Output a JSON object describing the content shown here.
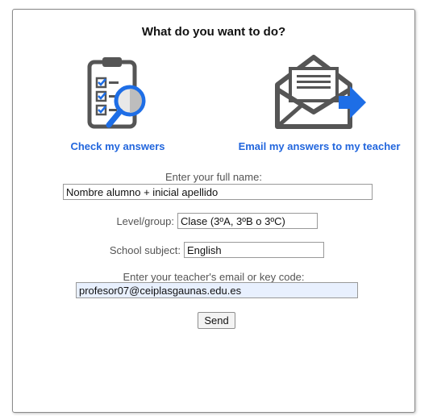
{
  "dialog": {
    "title": "What do you want to do?",
    "actions": [
      {
        "label": "Check my answers",
        "icon": "clipboard-magnifier-icon"
      },
      {
        "label": "Email my answers to my teacher",
        "icon": "envelope-arrow-icon"
      }
    ],
    "fields": {
      "full_name": {
        "label": "Enter your full name:",
        "value": "Nombre alumno + inicial apellido"
      },
      "level_group": {
        "label": "Level/group:",
        "value": "Clase (3ºA, 3ºB o 3ºC)"
      },
      "school_subject": {
        "label": "School subject:",
        "value": "English"
      },
      "teacher_email": {
        "label": "Enter your teacher's email or key code:",
        "value": "profesor07@ceiplasgaunas.edu.es"
      }
    },
    "send_button": "Send"
  },
  "colors": {
    "link": "#2266dd",
    "icon_gray": "#555555",
    "icon_blue": "#1e6ee6",
    "autofill_bg": "#e8f0fe"
  }
}
